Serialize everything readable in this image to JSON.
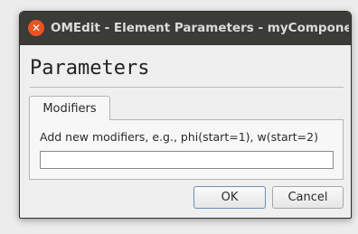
{
  "window": {
    "title": "OMEdit - Element Parameters - myCompone...",
    "close_glyph": "✕"
  },
  "heading": "Parameters",
  "tabs": [
    {
      "label": "Modifiers",
      "active": true
    }
  ],
  "modifiers": {
    "hint": "Add new modifiers, e.g., phi(start=1), w(start=2)",
    "value": "",
    "placeholder": ""
  },
  "buttons": {
    "ok_label": "OK",
    "cancel_label": "Cancel"
  },
  "colors": {
    "titlebar": "#3b3b38",
    "close_button": "#e95420",
    "dialog_background": "#efefef"
  }
}
